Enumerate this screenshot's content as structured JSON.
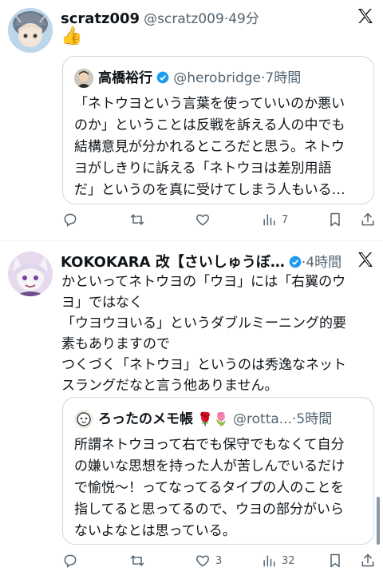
{
  "post1": {
    "display_name": "scratz009",
    "handle": "@scratz009",
    "time": "49分",
    "reaction": "👍",
    "quote": {
      "display_name": "高橋裕行",
      "handle": "@herobridge",
      "time": "7時間",
      "lines": [
        "「ネトウヨという言葉を使っていいのか悪い",
        "のか」ということは反戦を訴える人の中でも",
        "結構意見が分かれるところだと思う。ネトウ",
        "ヨがしきりに訴える「ネトウヨは差別用語",
        "だ」というのを真に受けてしまう人もいる…"
      ]
    },
    "actions": {
      "replies": "",
      "reposts": "",
      "likes": "",
      "views": "7"
    }
  },
  "post2": {
    "display_name": "KOKOKARA 改【さいしゅうぼ…",
    "time": "4時間",
    "lines": [
      "かといってネトウヨの「ウヨ」には「右翼のウ",
      "ヨ」ではなく",
      "「ウヨウヨいる」というダブルミーニング的要",
      "素もありますので",
      "つくづく「ネトウヨ」というのは秀逸なネット",
      "スラングだなと言う他ありません。"
    ],
    "quote": {
      "display_name": "ろったのメモ帳",
      "emoji": "🌹🌷",
      "handle": "@rotta...",
      "time": "5時間",
      "lines": [
        "所謂ネトウヨって右でも保守でもなくて自分",
        "の嫌いな思想を持った人が苦しんでいるだけ",
        "で愉悦〜！ってなってるタイプの人のことを",
        "指してると思ってるので、ウヨの部分がいら",
        "ないよなとは思っている。"
      ]
    },
    "actions": {
      "replies": "",
      "reposts": "",
      "likes": "3",
      "views": "32"
    }
  },
  "colors": {
    "verified": "#1d9bf0",
    "muted": "#536471",
    "border": "#cfd9de"
  }
}
